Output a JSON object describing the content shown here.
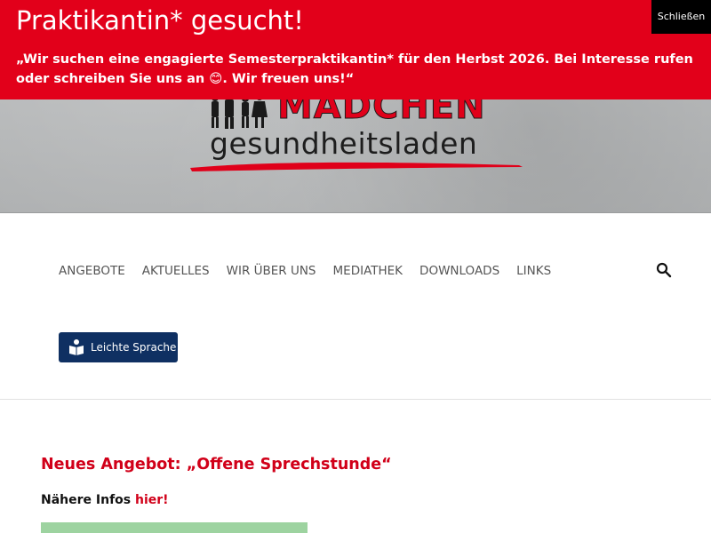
{
  "notice": {
    "title": "Praktikantin* gesucht!",
    "text": "„Wir suchen eine engagierte Semesterpraktikantin* für den Herbst 2026. Bei Interesse rufen oder schreiben Sie uns an 😊. Wir freuen uns!“",
    "close_label": "Schließen",
    "background_color": "#e2001a"
  },
  "logo": {
    "title": "MÄDCHEN",
    "subtitle": "gesundheitsladen"
  },
  "nav": {
    "items": [
      {
        "label": "ANGEBOTE"
      },
      {
        "label": "AKTUELLES"
      },
      {
        "label": "WIR ÜBER UNS"
      },
      {
        "label": "MEDIATHEK"
      },
      {
        "label": "DOWNLOADS"
      },
      {
        "label": "LINKS"
      }
    ],
    "search_icon": "search-icon"
  },
  "leichte_sprache": {
    "label": "Leichte Sprache",
    "icon": "reading-person-icon",
    "color": "#0f3062"
  },
  "content": {
    "headline": "Neues Angebot: „Offene Sprechstunde“",
    "more_info_prefix": "Nähere Infos ",
    "more_info_link": "hier!"
  }
}
